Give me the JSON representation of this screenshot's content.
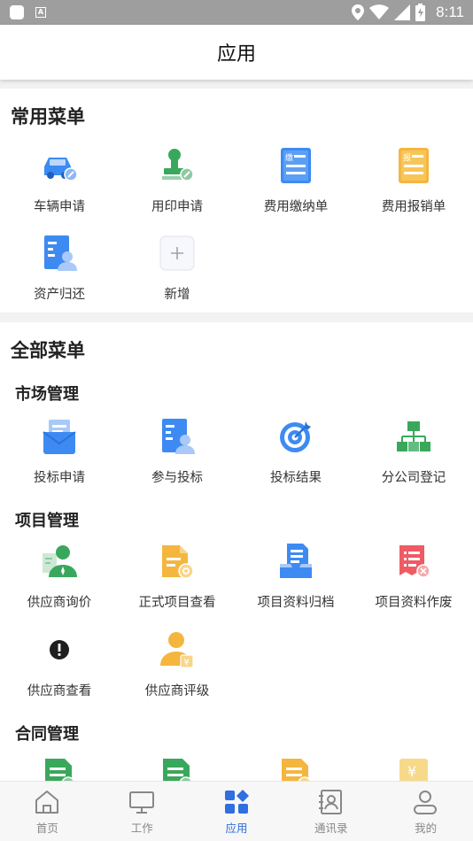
{
  "status_bar": {
    "time": "8:11",
    "badge": "A"
  },
  "header": {
    "title": "应用"
  },
  "common_menu": {
    "title": "常用菜单",
    "items": [
      {
        "label": "车辆申请",
        "icon": "car-icon"
      },
      {
        "label": "用印申请",
        "icon": "stamp-icon"
      },
      {
        "label": "费用缴纳单",
        "icon": "fee-payment-icon",
        "glyph": "缴"
      },
      {
        "label": "费用报销单",
        "icon": "reimbursement-icon",
        "glyph": "报"
      },
      {
        "label": "资产归还",
        "icon": "asset-return-icon"
      },
      {
        "label": "新增",
        "icon": "add-icon"
      }
    ]
  },
  "all_menu": {
    "title": "全部菜单",
    "groups": [
      {
        "title": "市场管理",
        "items": [
          {
            "label": "投标申请",
            "icon": "bid-apply-icon"
          },
          {
            "label": "参与投标",
            "icon": "bid-join-icon"
          },
          {
            "label": "投标结果",
            "icon": "target-icon"
          },
          {
            "label": "分公司登记",
            "icon": "org-chart-icon"
          }
        ]
      },
      {
        "title": "项目管理",
        "items": [
          {
            "label": "供应商询价",
            "icon": "supplier-inquiry-icon"
          },
          {
            "label": "正式项目查看",
            "icon": "project-view-icon"
          },
          {
            "label": "项目资料归档",
            "icon": "archive-icon"
          },
          {
            "label": "项目资料作废",
            "icon": "void-icon"
          },
          {
            "label": "供应商查看",
            "icon": "alert-icon"
          },
          {
            "label": "供应商评级",
            "icon": "supplier-rating-icon"
          }
        ]
      },
      {
        "title": "合同管理",
        "items": [
          {
            "label": "",
            "icon": "contract-doc-icon"
          },
          {
            "label": "",
            "icon": "contract-doc-icon"
          },
          {
            "label": "",
            "icon": "contract-doc-icon"
          },
          {
            "label": "",
            "icon": "yuan-icon",
            "glyph": "¥"
          }
        ]
      }
    ]
  },
  "tabs": [
    {
      "label": "首页",
      "icon": "home-icon",
      "active": false
    },
    {
      "label": "工作",
      "icon": "monitor-icon",
      "active": false
    },
    {
      "label": "应用",
      "icon": "apps-grid-icon",
      "active": true
    },
    {
      "label": "通讯录",
      "icon": "contacts-icon",
      "active": false
    },
    {
      "label": "我的",
      "icon": "user-icon",
      "active": false
    }
  ],
  "colors": {
    "accent": "#2f6fe0",
    "blue": "#3d8bf2",
    "green": "#3aa85c",
    "orange": "#f4b63f",
    "red": "#ef5b63"
  }
}
